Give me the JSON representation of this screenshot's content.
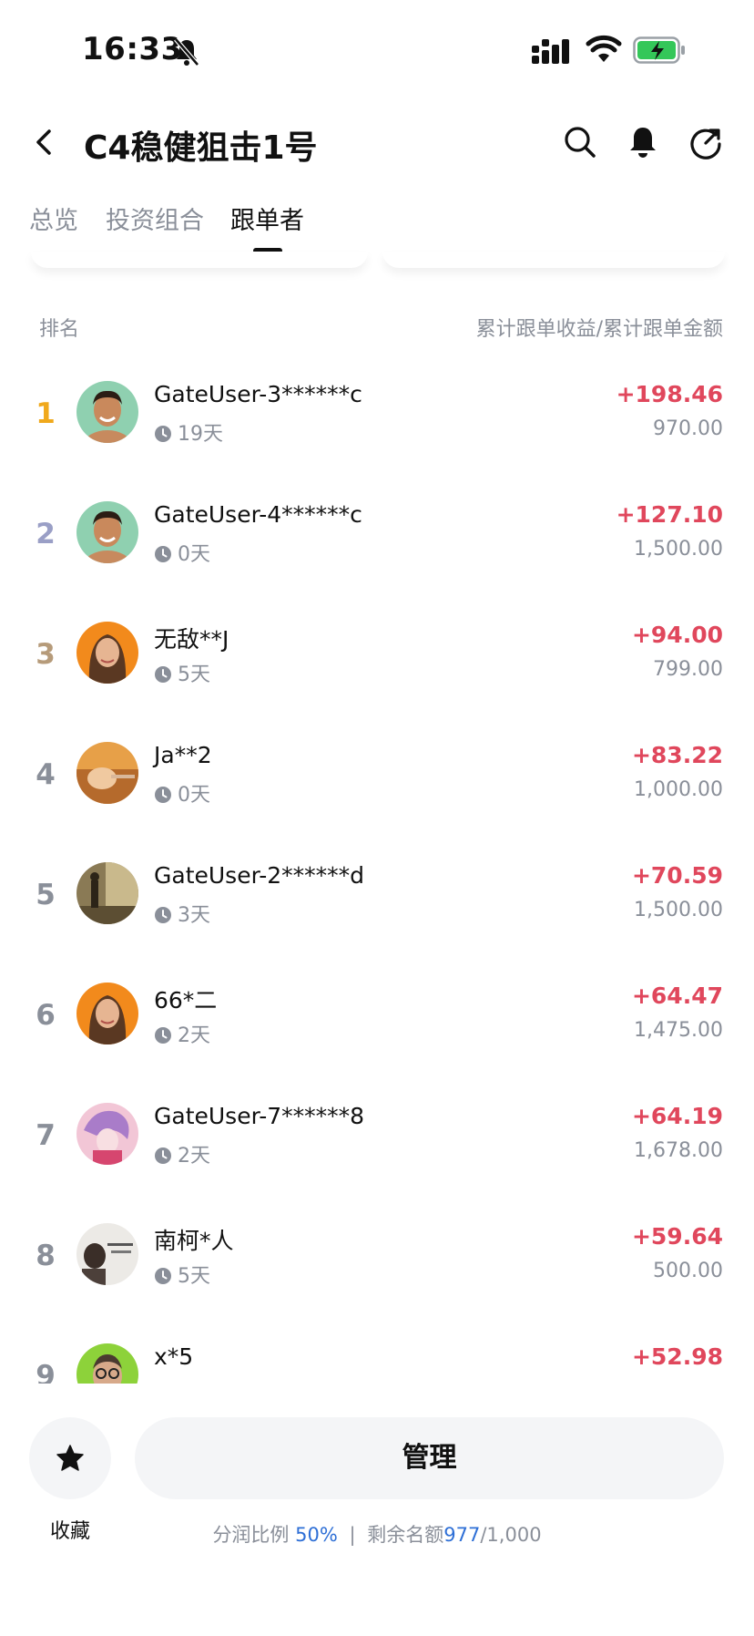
{
  "status_bar": {
    "time": "16:33",
    "icons": [
      "bell-slash-icon",
      "signal-icon",
      "wifi-icon",
      "battery-charging-icon"
    ]
  },
  "header": {
    "title": "C4稳健狙击1号",
    "icons": [
      "back-icon",
      "search-icon",
      "notification-bell-icon",
      "share-icon"
    ]
  },
  "tabs": [
    {
      "label": "总览",
      "active": false
    },
    {
      "label": "投资组合",
      "active": false
    },
    {
      "label": "跟单者",
      "active": true
    }
  ],
  "list_header": {
    "left": "排名",
    "right": "累计跟单收益/累计跟单金额"
  },
  "rank_colors": {
    "1": "#f0a91c",
    "2": "#9a9fc6",
    "3": "#b69b7a",
    "default": "#8a8f99"
  },
  "profit_color": "#e0475c",
  "followers": [
    {
      "rank": "1",
      "name": "GateUser-3******c",
      "days": "19天",
      "profit": "+198.46",
      "amount": "970.00",
      "avatar": "man-smiling-avatar"
    },
    {
      "rank": "2",
      "name": "GateUser-4******c",
      "days": "0天",
      "profit": "+127.10",
      "amount": "1,500.00",
      "avatar": "man-smiling-avatar"
    },
    {
      "rank": "3",
      "name": "无敌**J",
      "days": "5天",
      "profit": "+94.00",
      "amount": "799.00",
      "avatar": "woman-orange-avatar"
    },
    {
      "rank": "4",
      "name": "Ja**2",
      "days": "0天",
      "profit": "+83.22",
      "amount": "1,000.00",
      "avatar": "hand-photo-avatar"
    },
    {
      "rank": "5",
      "name": "GateUser-2******d",
      "days": "3天",
      "profit": "+70.59",
      "amount": "1,500.00",
      "avatar": "room-photo-avatar"
    },
    {
      "rank": "6",
      "name": "66*二",
      "days": "2天",
      "profit": "+64.47",
      "amount": "1,475.00",
      "avatar": "woman-orange-avatar"
    },
    {
      "rank": "7",
      "name": "GateUser-7******8",
      "days": "2天",
      "profit": "+64.19",
      "amount": "1,678.00",
      "avatar": "anime-pink-avatar"
    },
    {
      "rank": "8",
      "name": "南柯*人",
      "days": "5天",
      "profit": "+59.64",
      "amount": "500.00",
      "avatar": "sketch-person-avatar"
    },
    {
      "rank": "9",
      "name": "x*5",
      "days": "",
      "profit": "+52.98",
      "amount": "",
      "avatar": "man-glasses-green-avatar"
    }
  ],
  "bottom": {
    "favorite_label": "收藏",
    "manage_label": "管理",
    "share_ratio_label": "分润比例",
    "share_ratio_value": "50%",
    "separator": "|",
    "remaining_label": "剩余名额",
    "remaining_value": "977",
    "remaining_total": "/1,000"
  }
}
